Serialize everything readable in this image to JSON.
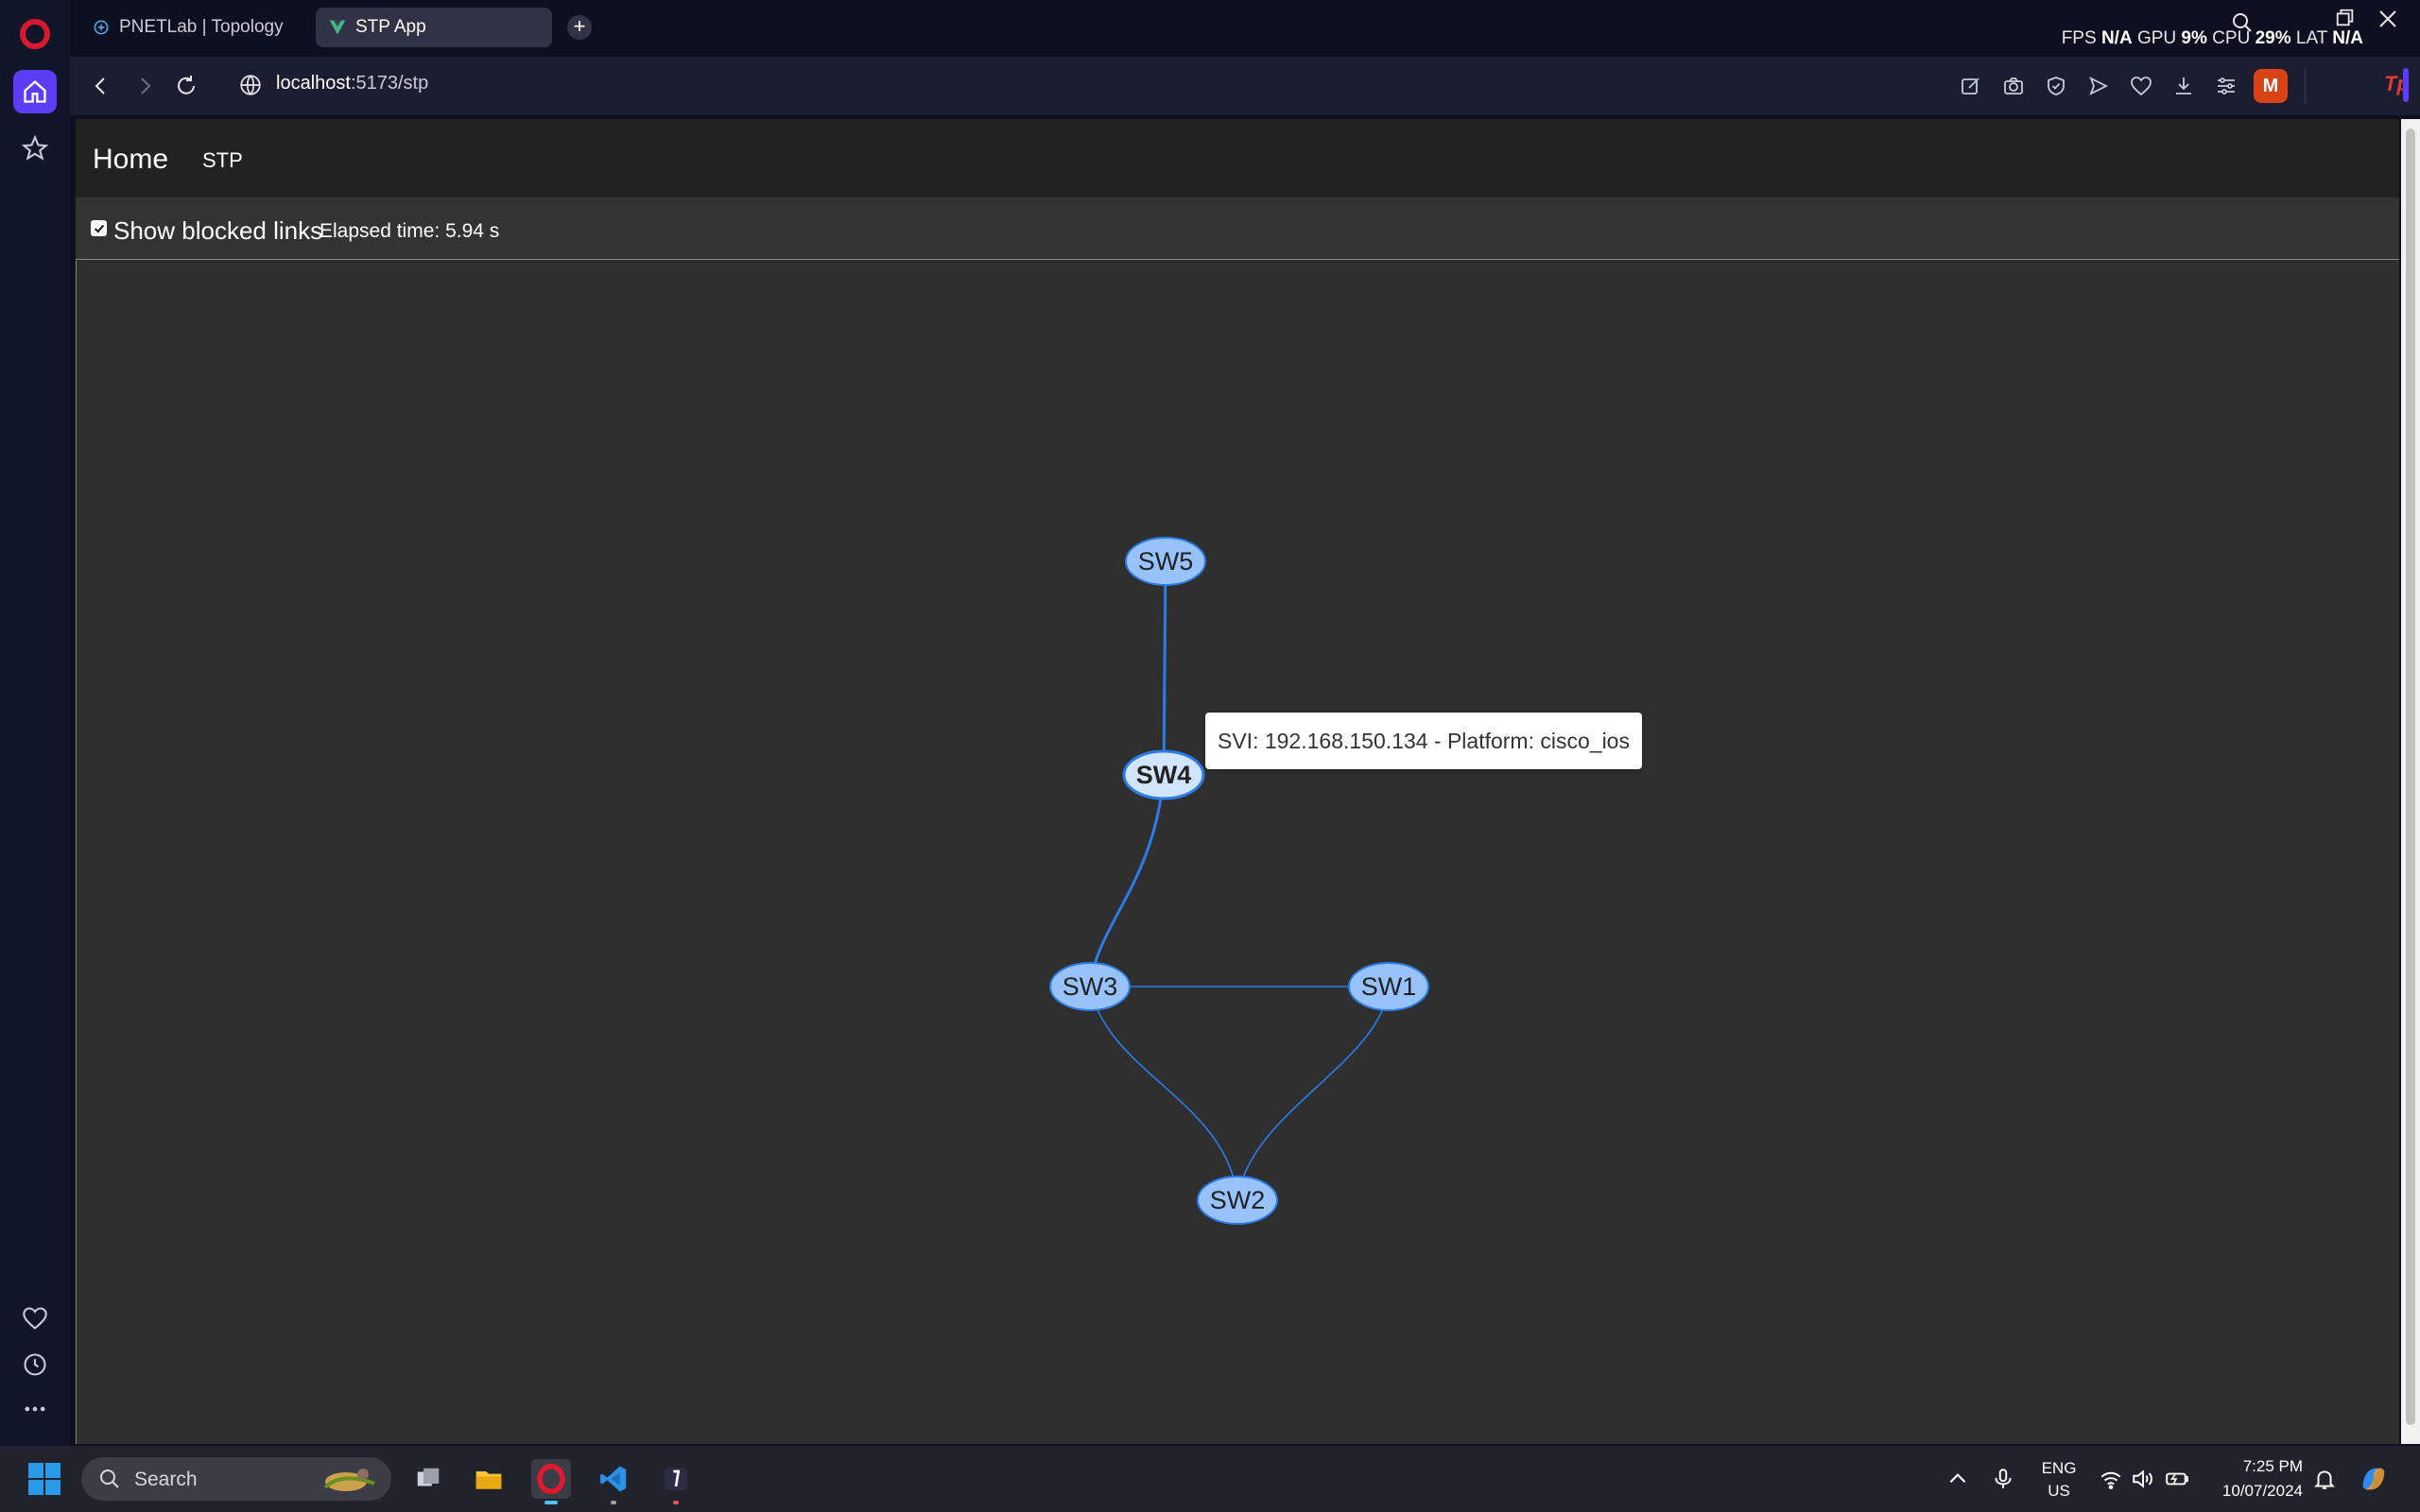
{
  "browser": {
    "tabs": [
      {
        "title": "PNETLab | Topology",
        "active": false
      },
      {
        "title": "STP App",
        "active": true
      }
    ],
    "url_host": "localhost",
    "url_path": ":5173/stp",
    "perf": {
      "fps_label": "FPS",
      "fps_value": "N/A",
      "gpu_label": "GPU",
      "gpu_value": "9%",
      "cpu_label": "CPU",
      "cpu_value": "29%",
      "lat_label": "LAT",
      "lat_value": "N/A"
    },
    "avatar_initial": "M",
    "extension_label": "Tp"
  },
  "app": {
    "brand": "Home",
    "nav_link": "STP",
    "show_blocked_label": "Show blocked links",
    "show_blocked_checked": true,
    "elapsed": "Elapsed time: 5.94 s"
  },
  "topology": {
    "nodes": [
      {
        "id": "SW5",
        "label": "SW5",
        "bold": false
      },
      {
        "id": "SW4",
        "label": "SW4",
        "bold": true
      },
      {
        "id": "SW3",
        "label": "SW3",
        "bold": false
      },
      {
        "id": "SW1",
        "label": "SW1",
        "bold": false
      },
      {
        "id": "SW2",
        "label": "SW2",
        "bold": false
      }
    ],
    "links": [
      {
        "from": "SW5",
        "to": "SW4",
        "style": "thick"
      },
      {
        "from": "SW4",
        "to": "SW3",
        "style": "thick"
      },
      {
        "from": "SW3",
        "to": "SW1",
        "style": "thin"
      },
      {
        "from": "SW3",
        "to": "SW2",
        "style": "thin"
      },
      {
        "from": "SW1",
        "to": "SW2",
        "style": "thin"
      }
    ],
    "tooltip": "SVI: 192.168.150.134 - Platform: cisco_ios",
    "colors": {
      "node_fill": "#97c2fc",
      "node_border": "#2b7ce9",
      "hover_fill": "#d2e5ff",
      "link": "#2b7ce9"
    }
  },
  "taskbar": {
    "search_label": "Search",
    "lang_top": "ENG",
    "lang_bottom": "US",
    "time": "7:25 PM",
    "date": "10/07/2024"
  }
}
